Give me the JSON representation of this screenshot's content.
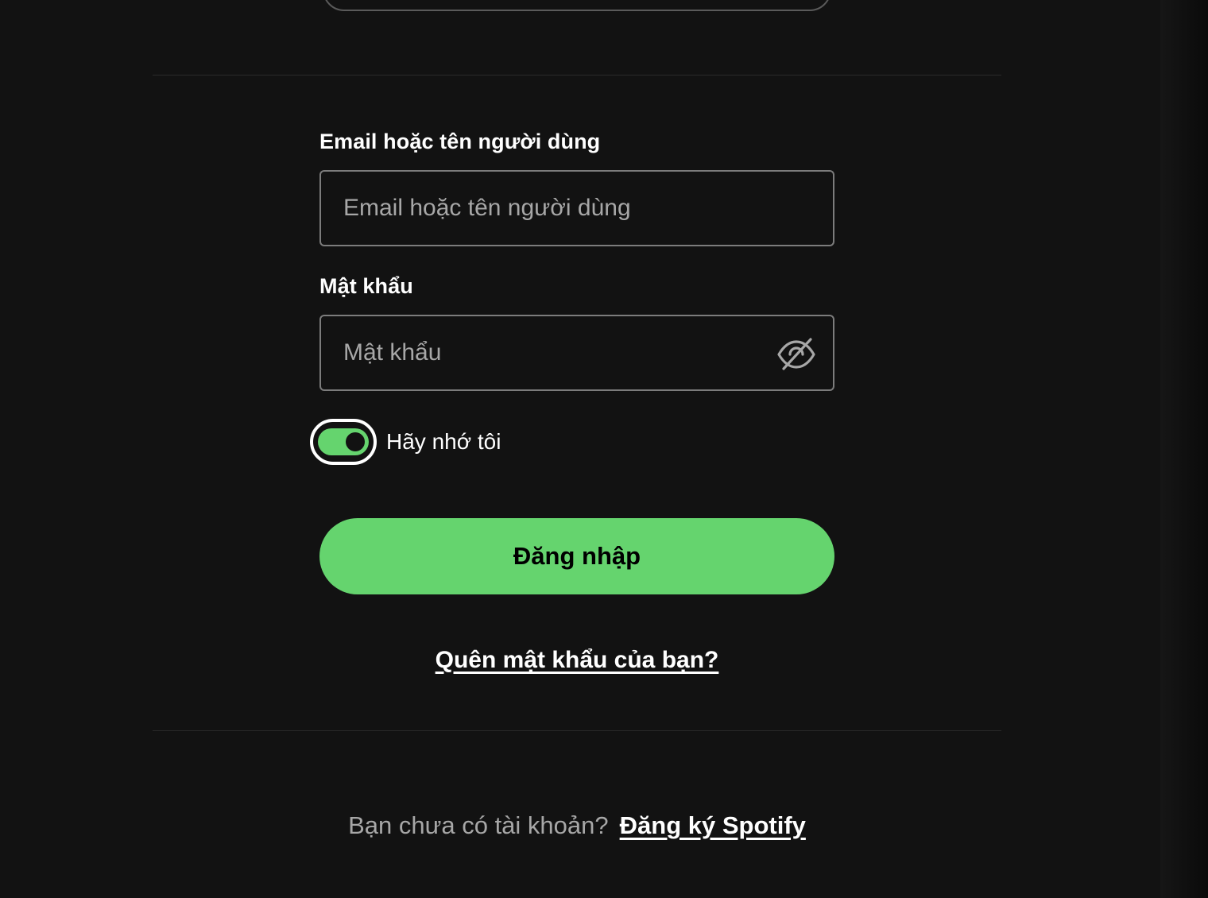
{
  "form": {
    "email_label": "Email hoặc tên người dùng",
    "email_placeholder": "Email hoặc tên người dùng",
    "password_label": "Mật khẩu",
    "password_placeholder": "Mật khẩu",
    "password_visibility_icon": "eye-off-icon",
    "remember_me_label": "Hãy nhớ tôi",
    "remember_me_checked": true,
    "login_button": "Đăng nhập",
    "forgot_password_link": "Quên mật khẩu của bạn?"
  },
  "footer": {
    "no_account_text": "Bạn chưa có tài khoản?",
    "signup_link": "Đăng ký Spotify"
  },
  "colors": {
    "background": "#121212",
    "accent_green": "#65d46e",
    "text_primary": "#ffffff",
    "text_secondary": "#a7a7a7",
    "input_border": "#7c7c7c"
  }
}
